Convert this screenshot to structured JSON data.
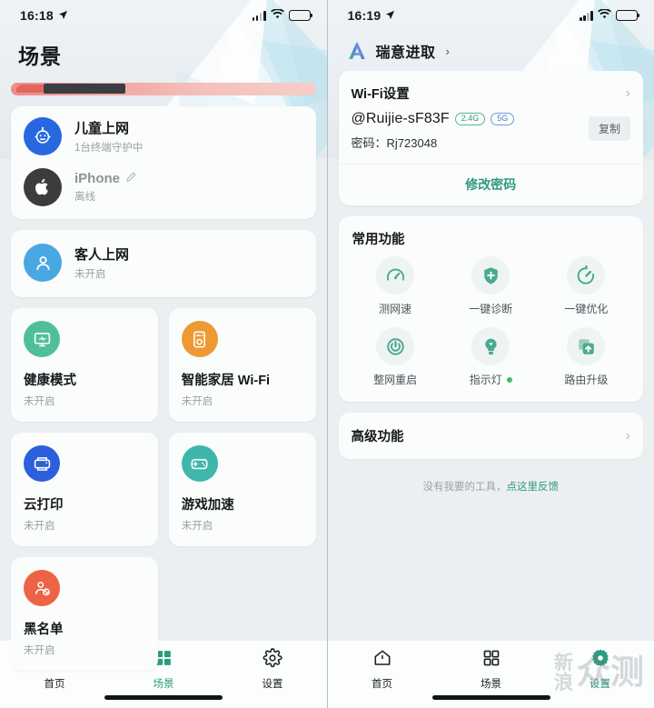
{
  "left": {
    "status": {
      "time": "16:18",
      "location_icon": "location-arrow-icon",
      "signal_icon": "cellular-signal-icon",
      "wifi_icon": "wifi-icon",
      "battery_icon": "battery-icon"
    },
    "page_title": "场景",
    "banner": {
      "name": "promo-banner-sliver"
    },
    "child_card": {
      "title": "儿童上网",
      "subtitle": "1台终端守护中",
      "device_name": "iPhone",
      "device_status": "离线",
      "edit_icon": "pencil-edit-icon"
    },
    "guest_card": {
      "title": "客人上网",
      "subtitle": "未开启"
    },
    "tiles": [
      {
        "title": "健康模式",
        "sub": "未开启",
        "icon": "monitor-icon",
        "color": "#4fbf9a"
      },
      {
        "title": "智能家居 Wi-Fi",
        "sub": "未开启",
        "icon": "smart-home-device-icon",
        "color": "#ed9a33"
      },
      {
        "title": "云打印",
        "sub": "未开启",
        "icon": "printer-icon",
        "color": "#2b5fdc"
      },
      {
        "title": "游戏加速",
        "sub": "未开启",
        "icon": "gamepad-icon",
        "color": "#3fb6ac"
      },
      {
        "title": "黑名单",
        "sub": "未开启",
        "icon": "blocked-user-icon",
        "color": "#ee6343"
      }
    ],
    "tabs": [
      {
        "label": "首页",
        "icon": "home-icon",
        "active": false
      },
      {
        "label": "场景",
        "icon": "grid-squares-icon",
        "active": true
      },
      {
        "label": "设置",
        "icon": "gear-icon",
        "active": false
      }
    ]
  },
  "right": {
    "status": {
      "time": "16:19",
      "location_icon": "location-arrow-icon",
      "signal_icon": "cellular-signal-icon",
      "wifi_icon": "wifi-icon",
      "battery_icon": "battery-icon"
    },
    "brand": {
      "name": "瑞意进取",
      "logo_icon": "ruijie-logo-icon",
      "chevron": "›"
    },
    "wifi": {
      "section_title": "Wi-Fi设置",
      "chevron": "›",
      "ssid": "@Ruijie-sF83F",
      "badge_24g": "2.4G",
      "badge_5g": "5G",
      "password_label": "密码：",
      "password_value": "Rj723048",
      "copy_label": "复制",
      "change_password_label": "修改密码"
    },
    "tools": {
      "section_title": "常用功能",
      "items": [
        {
          "label": "测网速",
          "icon": "speedometer-icon"
        },
        {
          "label": "一键诊断",
          "icon": "shield-plus-icon"
        },
        {
          "label": "一键优化",
          "icon": "optimize-circle-icon"
        },
        {
          "label": "整网重启",
          "icon": "power-restart-icon"
        },
        {
          "label": "指示灯",
          "icon": "lightbulb-icon",
          "status_dot": true
        },
        {
          "label": "路由升级",
          "icon": "upload-upgrade-icon"
        }
      ]
    },
    "advanced": {
      "title": "高级功能",
      "chevron": "›"
    },
    "feedback": {
      "text": "没有我要的工具，",
      "link": "点这里反馈"
    },
    "tabs": [
      {
        "label": "首页",
        "icon": "home-icon",
        "active": false
      },
      {
        "label": "场景",
        "icon": "grid-squares-icon",
        "active": false
      },
      {
        "label": "设置",
        "icon": "gear-icon",
        "active": true
      }
    ],
    "watermark": {
      "c1": "新",
      "c2": "浪",
      "c3": "众",
      "c4": "测"
    }
  }
}
